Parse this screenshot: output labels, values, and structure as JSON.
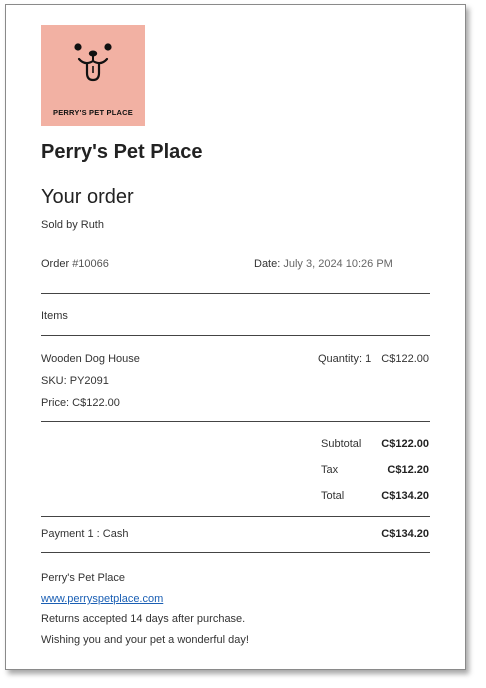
{
  "logo": {
    "text": "PERRY'S PET PLACE",
    "background_color": "#f2b1a3",
    "icon": "dog-face-icon"
  },
  "store_name": "Perry's Pet Place",
  "heading": "Your order",
  "sold_by": "Sold by Ruth",
  "order": {
    "number_label": "Order ",
    "number_value": "#10066",
    "date_label": "Date: ",
    "date_value": "July 3, 2024 10:26 PM"
  },
  "items_header": "Items",
  "items": [
    {
      "name": "Wooden Dog House",
      "sku": "SKU: PY2091",
      "price": "Price: C$122.00",
      "quantity": "Quantity: 1",
      "total": "C$122.00"
    }
  ],
  "totals": {
    "subtotal_label": "Subtotal",
    "subtotal_value": "C$122.00",
    "tax_label": "Tax",
    "tax_value": "C$12.20",
    "total_label": "Total",
    "total_value": "C$134.20"
  },
  "payment": {
    "label": "Payment 1 : Cash",
    "amount": "C$134.20"
  },
  "footer": {
    "store_name": "Perry's Pet Place",
    "website": "www.perryspetplace.com",
    "returns": "Returns accepted 14 days after purchase.",
    "message": "Wishing you and your pet a wonderful day!"
  },
  "colors": {
    "link": "#1a5fb4",
    "rule": "#444444"
  }
}
